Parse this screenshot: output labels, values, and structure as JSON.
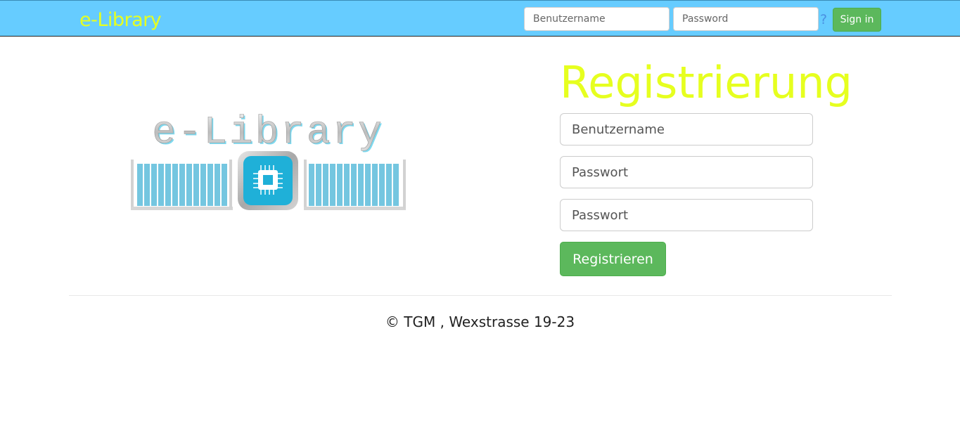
{
  "navbar": {
    "brand": "e-Library",
    "username_placeholder": "Benutzername",
    "password_placeholder": "Password",
    "help_label": "?",
    "signin_label": "Sign in"
  },
  "logo": {
    "text": "e-Library",
    "icon": "chip-icon"
  },
  "registration": {
    "title": "Registrierung",
    "username_placeholder": "Benutzername",
    "password_placeholder": "Passwort",
    "password_confirm_placeholder": "Passwort",
    "submit_label": "Registrieren"
  },
  "footer": {
    "text": "© TGM , Wexstrasse 19-23"
  },
  "colors": {
    "navbar_bg": "#66ccff",
    "brand": "#e6ff1f",
    "button_green": "#5cb85c",
    "logo_blue": "#1fb0d8"
  }
}
